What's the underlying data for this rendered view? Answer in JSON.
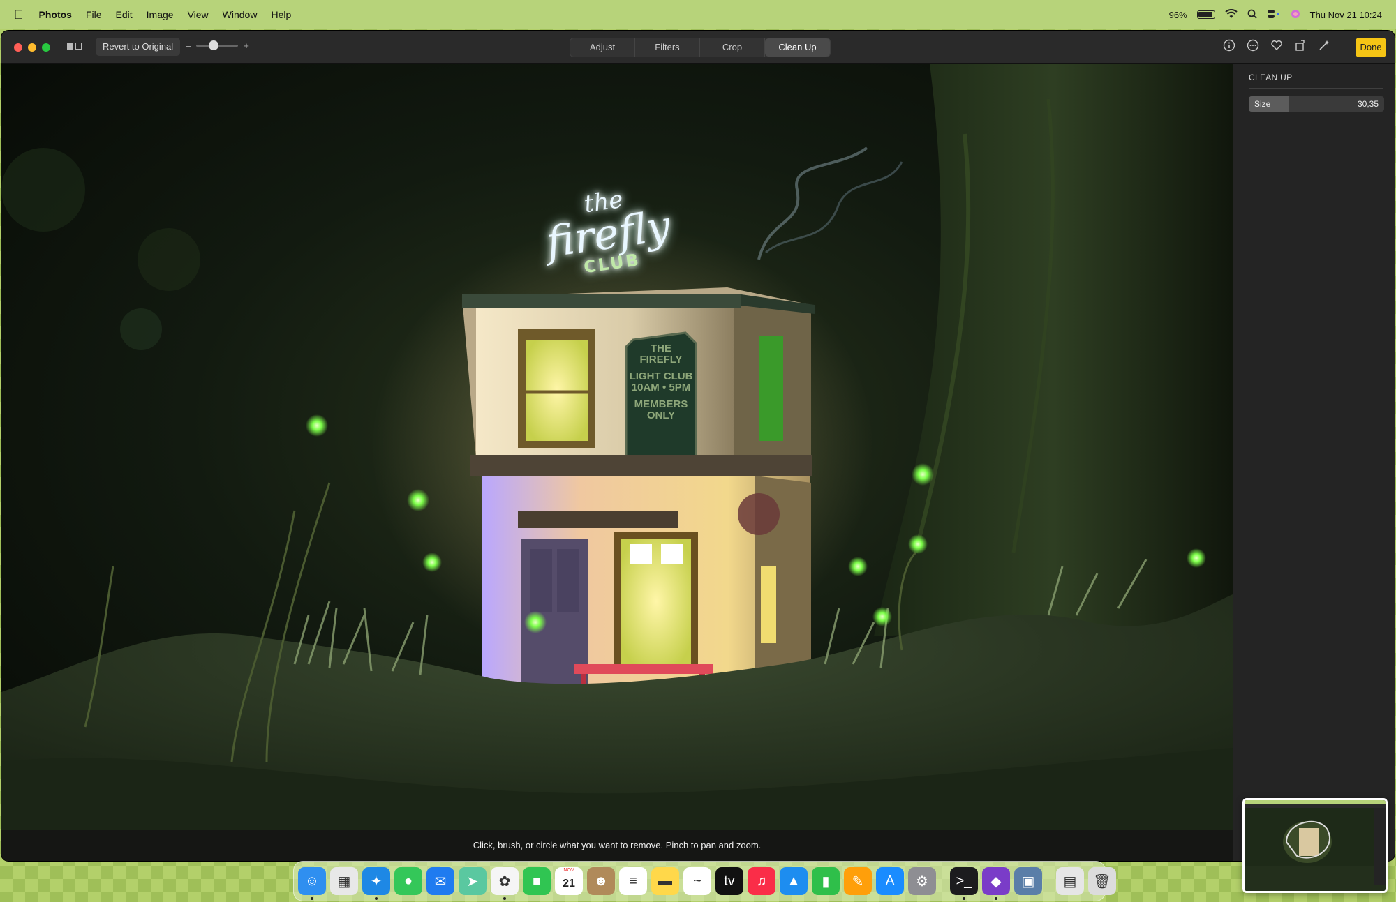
{
  "menubar": {
    "app_name": "Photos",
    "items": [
      "File",
      "Edit",
      "Image",
      "View",
      "Window",
      "Help"
    ],
    "battery": "96%",
    "datetime": "Thu Nov 21  10:24"
  },
  "toolbar": {
    "revert_label": "Revert to Original",
    "zoom_minus": "–",
    "zoom_plus": "+",
    "tabs": [
      "Adjust",
      "Filters",
      "Crop",
      "Clean Up"
    ],
    "active_tab": "Clean Up",
    "done_label": "Done"
  },
  "photo": {
    "sign_title_1": "the",
    "sign_title_2": "firefly",
    "sign_title_3": "CLUB",
    "plaque": [
      "THE",
      "FIREFLY",
      "LIGHT CLUB",
      "10AM • 5PM",
      "MEMBERS",
      "ONLY"
    ],
    "hint": "Click, brush, or circle what you want to remove. Pinch to pan and zoom."
  },
  "panel": {
    "title": "CLEAN UP",
    "size_label": "Size",
    "size_value": "30,35",
    "size_fraction": 0.3
  },
  "dock": {
    "apps": [
      {
        "name": "finder",
        "glyph": "☺",
        "color": "#2f8ff0",
        "running": true
      },
      {
        "name": "launchpad",
        "glyph": "▦",
        "color": "#e8e8e8",
        "running": false
      },
      {
        "name": "safari",
        "glyph": "✦",
        "color": "#1e88e5",
        "running": true
      },
      {
        "name": "messages",
        "glyph": "●",
        "color": "#34c759",
        "running": false
      },
      {
        "name": "mail",
        "glyph": "✉",
        "color": "#1f7bf0",
        "running": false
      },
      {
        "name": "maps",
        "glyph": "➤",
        "color": "#5ac8a0",
        "running": false
      },
      {
        "name": "photos",
        "glyph": "✿",
        "color": "#f5f5f5",
        "running": true
      },
      {
        "name": "facetime",
        "glyph": "■",
        "color": "#30c552",
        "running": false
      },
      {
        "name": "calendar",
        "glyph": "21",
        "color": "#ffffff",
        "running": false
      },
      {
        "name": "contacts",
        "glyph": "☻",
        "color": "#b08a5a",
        "running": false
      },
      {
        "name": "reminders",
        "glyph": "≡",
        "color": "#ffffff",
        "running": false
      },
      {
        "name": "notes",
        "glyph": "▬",
        "color": "#ffd84a",
        "running": false
      },
      {
        "name": "freeform",
        "glyph": "~",
        "color": "#ffffff",
        "running": false
      },
      {
        "name": "tv",
        "glyph": "tv",
        "color": "#111111",
        "running": false
      },
      {
        "name": "music",
        "glyph": "♫",
        "color": "#fa2d48",
        "running": false
      },
      {
        "name": "keynote",
        "glyph": "▲",
        "color": "#1d8df0",
        "running": false
      },
      {
        "name": "numbers",
        "glyph": "▮",
        "color": "#2fbf4a",
        "running": false
      },
      {
        "name": "pages",
        "glyph": "✎",
        "color": "#ff9f0a",
        "running": false
      },
      {
        "name": "app-store",
        "glyph": "A",
        "color": "#1a8cff",
        "running": false
      },
      {
        "name": "system-settings",
        "glyph": "⚙",
        "color": "#8e8e93",
        "running": false
      },
      {
        "name": "terminal",
        "glyph": ">_",
        "color": "#1c1c1e",
        "running": true
      },
      {
        "name": "affinity",
        "glyph": "◆",
        "color": "#7a3cc8",
        "running": true
      },
      {
        "name": "preview",
        "glyph": "▣",
        "color": "#5a7ea8",
        "running": false
      },
      {
        "name": "documents",
        "glyph": "▤",
        "color": "#e6e6e6",
        "running": false
      },
      {
        "name": "trash",
        "glyph": "🗑",
        "color": "#dcdcdc",
        "running": false
      }
    ],
    "calendar_month": "NOV",
    "calendar_day": "21"
  },
  "colors": {
    "done_button": "#f6c515",
    "neon_sign": "#e9f7ff",
    "firefly_glow": "#7dff4a"
  }
}
